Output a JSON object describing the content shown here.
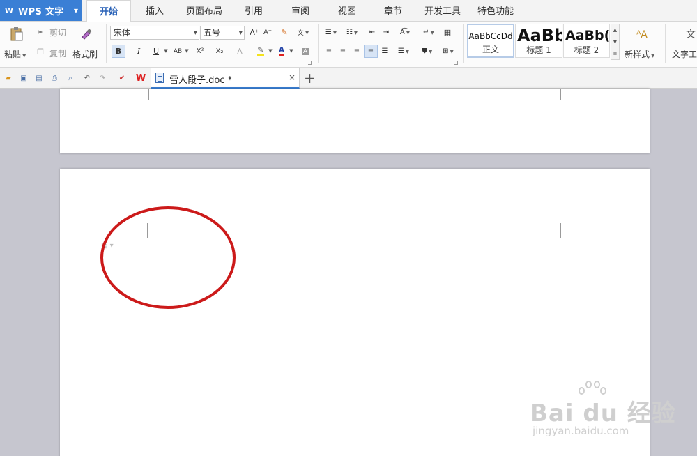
{
  "app": {
    "logo_glyph": "W",
    "title": "WPS 文字",
    "menu_caret": "▼"
  },
  "tabs": [
    {
      "label": "开始",
      "active": true
    },
    {
      "label": "插入"
    },
    {
      "label": "页面布局"
    },
    {
      "label": "引用"
    },
    {
      "label": "审阅"
    },
    {
      "label": "视图"
    },
    {
      "label": "章节"
    },
    {
      "label": "开发工具"
    },
    {
      "label": "特色功能"
    }
  ],
  "clipboard": {
    "paste": "粘贴",
    "cut": "剪切",
    "copy": "复制",
    "format_painter": "格式刷"
  },
  "font": {
    "family": "宋体",
    "size": "五号",
    "bold": "B",
    "italic": "I",
    "underline": "U",
    "strike": "AB",
    "superscript": "X²",
    "subscript": "X₂",
    "font_color": "A",
    "char_shade": "A",
    "grow": "A⁺",
    "shrink": "A⁻"
  },
  "styles": {
    "items": [
      {
        "sample": "AaBbCcDd",
        "name": "正文"
      },
      {
        "sample": "AaBb",
        "name": "标题 1"
      },
      {
        "sample": "AaBb(",
        "name": "标题 2"
      }
    ],
    "new_style": "新样式",
    "text_tools": "文字工"
  },
  "quickbar": {
    "doc_name": "雷人段子.doc *",
    "close": "×",
    "new_tab": "+"
  },
  "watermark": {
    "brand": "Bai du 经验",
    "url": "jingyan.baidu.com"
  },
  "colors": {
    "accent": "#3a7fd5",
    "annotation": "#cc1a1a"
  }
}
